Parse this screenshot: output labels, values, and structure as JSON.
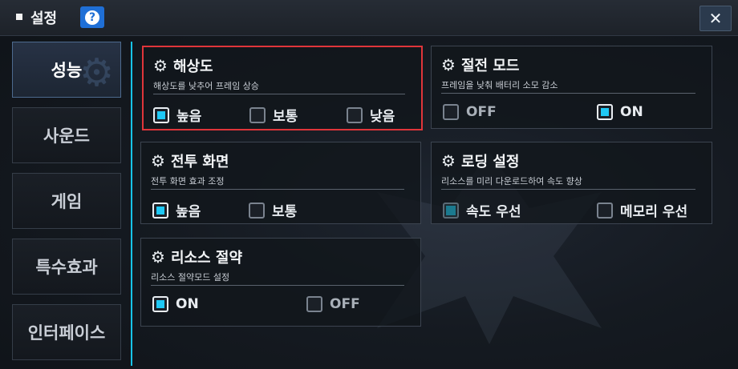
{
  "titlebar": {
    "title": "설정",
    "help_label": "?",
    "close_label": "✕"
  },
  "sidebar": {
    "items": [
      {
        "label": "성능",
        "active": true
      },
      {
        "label": "사운드",
        "active": false
      },
      {
        "label": "게임",
        "active": false
      },
      {
        "label": "특수효과",
        "active": false
      },
      {
        "label": "인터페이스",
        "active": false
      }
    ]
  },
  "icons": {
    "panel": "gear-icon",
    "close": "close-icon",
    "help": "help-icon"
  },
  "colors": {
    "accent": "#1ec8f5",
    "highlight_border": "#e0353a",
    "help_button": "#1f6fd6"
  },
  "panels": {
    "resolution": {
      "title": "해상도",
      "desc": "해상도를 낮추어 프레임 상승",
      "options": [
        {
          "label": "높음",
          "checked": true
        },
        {
          "label": "보통",
          "checked": false
        },
        {
          "label": "낮음",
          "checked": false
        }
      ]
    },
    "power_save": {
      "title": "절전 모드",
      "desc": "프레임을 낮춰 배터리 소모 감소",
      "options": [
        {
          "label": "OFF",
          "checked": false
        },
        {
          "label": "ON",
          "checked": true
        }
      ]
    },
    "battle_screen": {
      "title": "전투 화면",
      "desc": "전투 화면 효과 조정",
      "options": [
        {
          "label": "높음",
          "checked": true
        },
        {
          "label": "보통",
          "checked": false
        }
      ]
    },
    "loading": {
      "title": "로딩 설정",
      "desc": "리소스를 미리 다운로드하여 속도 향상",
      "options": [
        {
          "label": "속도 우선",
          "checked": true
        },
        {
          "label": "메모리 우선",
          "checked": false
        }
      ]
    },
    "resource_save": {
      "title": "리소스 절약",
      "desc": "리소스 절약모드 설정",
      "options": [
        {
          "label": "ON",
          "checked": true
        },
        {
          "label": "OFF",
          "checked": false
        }
      ]
    }
  }
}
